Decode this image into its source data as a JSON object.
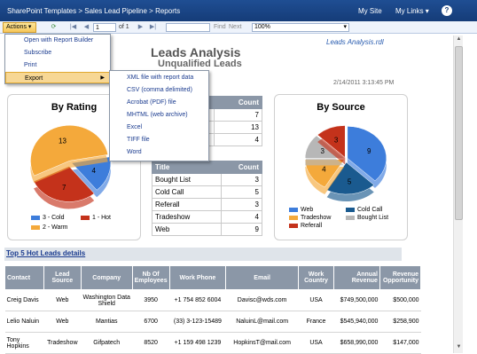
{
  "topbar": {
    "breadcrumb": "SharePoint Templates > Sales Lead Pipeline > Reports",
    "my_site": "My Site",
    "my_links": "My Links",
    "help": "?"
  },
  "toolbar": {
    "actions_label": "Actions",
    "page_value": "1",
    "page_of": "of 1",
    "find_placeholder": "",
    "find_label": "Find",
    "next_label": "Next",
    "zoom_value": "100%"
  },
  "actions_menu": {
    "items": [
      "Open with Report Builder",
      "Subscribe",
      "Print",
      "Export"
    ]
  },
  "export_menu": {
    "items": [
      "XML file with report data",
      "CSV (comma delimited)",
      "Acrobat (PDF) file",
      "MHTML (web archive)",
      "Excel",
      "TIFF file",
      "Word"
    ]
  },
  "report": {
    "rdl_name": "Leads Analysis.rdl",
    "title": "Leads Analysis",
    "subtitle": "Unqualified Leads",
    "timestamp": "2/14/2011 3:13:45 PM",
    "hot_leads_link": "Top 5 Hot Leads details"
  },
  "chart_data": [
    {
      "type": "pie",
      "title": "By Rating",
      "categories": [
        "3 - Cold",
        "1 - Hot",
        "2 - Warm"
      ],
      "values": [
        4,
        7,
        13
      ],
      "colors": [
        "#3d7ddb",
        "#c4321b",
        "#f4a93b"
      ]
    },
    {
      "type": "pie",
      "title": "By Source",
      "categories": [
        "Web",
        "Cold Call",
        "Tradeshow",
        "Bought List",
        "Referall"
      ],
      "values": [
        9,
        5,
        4,
        3,
        3
      ],
      "colors": [
        "#3d7ddb",
        "#1a5a8f",
        "#f4a93b",
        "#b7b7b7",
        "#c4321b"
      ]
    }
  ],
  "table_rating": {
    "headers": [
      "",
      "Count"
    ],
    "rows": [
      [
        "",
        "7"
      ],
      [
        "",
        "13"
      ],
      [
        "",
        "4"
      ]
    ]
  },
  "table_source": {
    "headers": [
      "Title",
      "Count"
    ],
    "rows": [
      [
        "Bought List",
        "3"
      ],
      [
        "Cold Call",
        "5"
      ],
      [
        "Referall",
        "3"
      ],
      [
        "Tradeshow",
        "4"
      ],
      [
        "Web",
        "9"
      ]
    ]
  },
  "leads_table": {
    "headers": [
      "Contact",
      "Lead Source",
      "Company",
      "Nb Of Employees",
      "Work Phone",
      "Email",
      "Work Country",
      "Annual Revenue",
      "Revenue Opportunity"
    ],
    "rows": [
      [
        "Creig Davis",
        "Web",
        "Washington Data Shield",
        "3950",
        "+1 754 852 6004",
        "Davisc@wds.com",
        "USA",
        "$749,500,000",
        "$500,000"
      ],
      [
        "Lelio Naluin",
        "Web",
        "Mantias",
        "6700",
        "(33) 3-123-15489",
        "NaluinL@mail.com",
        "France",
        "$545,940,000",
        "$258,900"
      ],
      [
        "Tony Hopkins",
        "Tradeshow",
        "Gifpatech",
        "8520",
        "+1 159 498 1239",
        "HopkinsT@mail.com",
        "USA",
        "$658,990,000",
        "$147,000"
      ]
    ]
  }
}
